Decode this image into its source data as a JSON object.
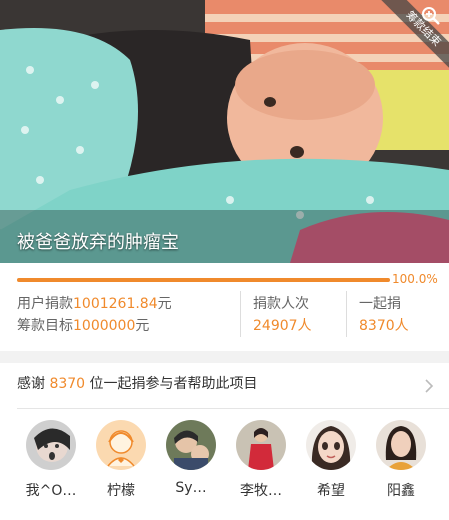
{
  "project": {
    "title": "被爸爸放弃的肿瘤宝",
    "ribbon": "筹款结束",
    "progress_pct": 100.0,
    "progress_label": "100.0%"
  },
  "stats": {
    "donated_label": "用户捐款",
    "donated_value": "1001261.84",
    "donated_unit": "元",
    "target_label": "筹款目标",
    "target_value": "1000000",
    "target_unit": "元",
    "donations_label": "捐款人次",
    "donations_value": "24907",
    "donations_unit": "人",
    "together_label": "一起捐",
    "together_value": "8370",
    "together_unit": "人"
  },
  "thanks": {
    "prefix": "感谢 ",
    "count": "8370",
    "suffix": " 位一起捐参与者帮助此项目"
  },
  "donors": [
    {
      "name": "我^O…"
    },
    {
      "name": "柠檬"
    },
    {
      "name": "Sy…"
    },
    {
      "name": "李牧…"
    },
    {
      "name": "希望"
    },
    {
      "name": "阳鑫"
    }
  ],
  "colors": {
    "accent": "#f08a2c"
  },
  "icons": {
    "zoom": "zoom-in-icon",
    "chevron": "chevron-right-icon"
  }
}
